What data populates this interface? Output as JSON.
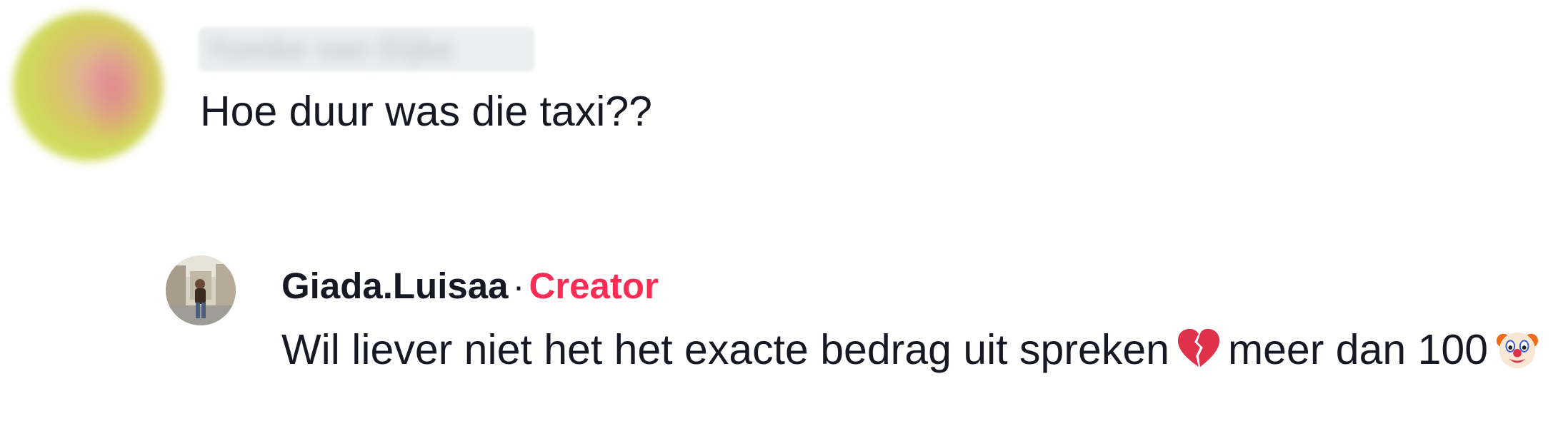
{
  "comments": [
    {
      "username": "Yumke van Dijke",
      "text": "Hoe duur was die taxi??"
    },
    {
      "username": "Giada.Luisaa",
      "separator": "·",
      "badge": "Creator",
      "text_part1": "Wil liever niet het het exacte bedrag uit spreken",
      "emoji1": "broken-heart-emoji",
      "text_part2": "meer dan 100",
      "emoji2": "clown-face-emoji"
    }
  ],
  "colors": {
    "creator_badge": "#fe2c55",
    "text": "#161823"
  }
}
